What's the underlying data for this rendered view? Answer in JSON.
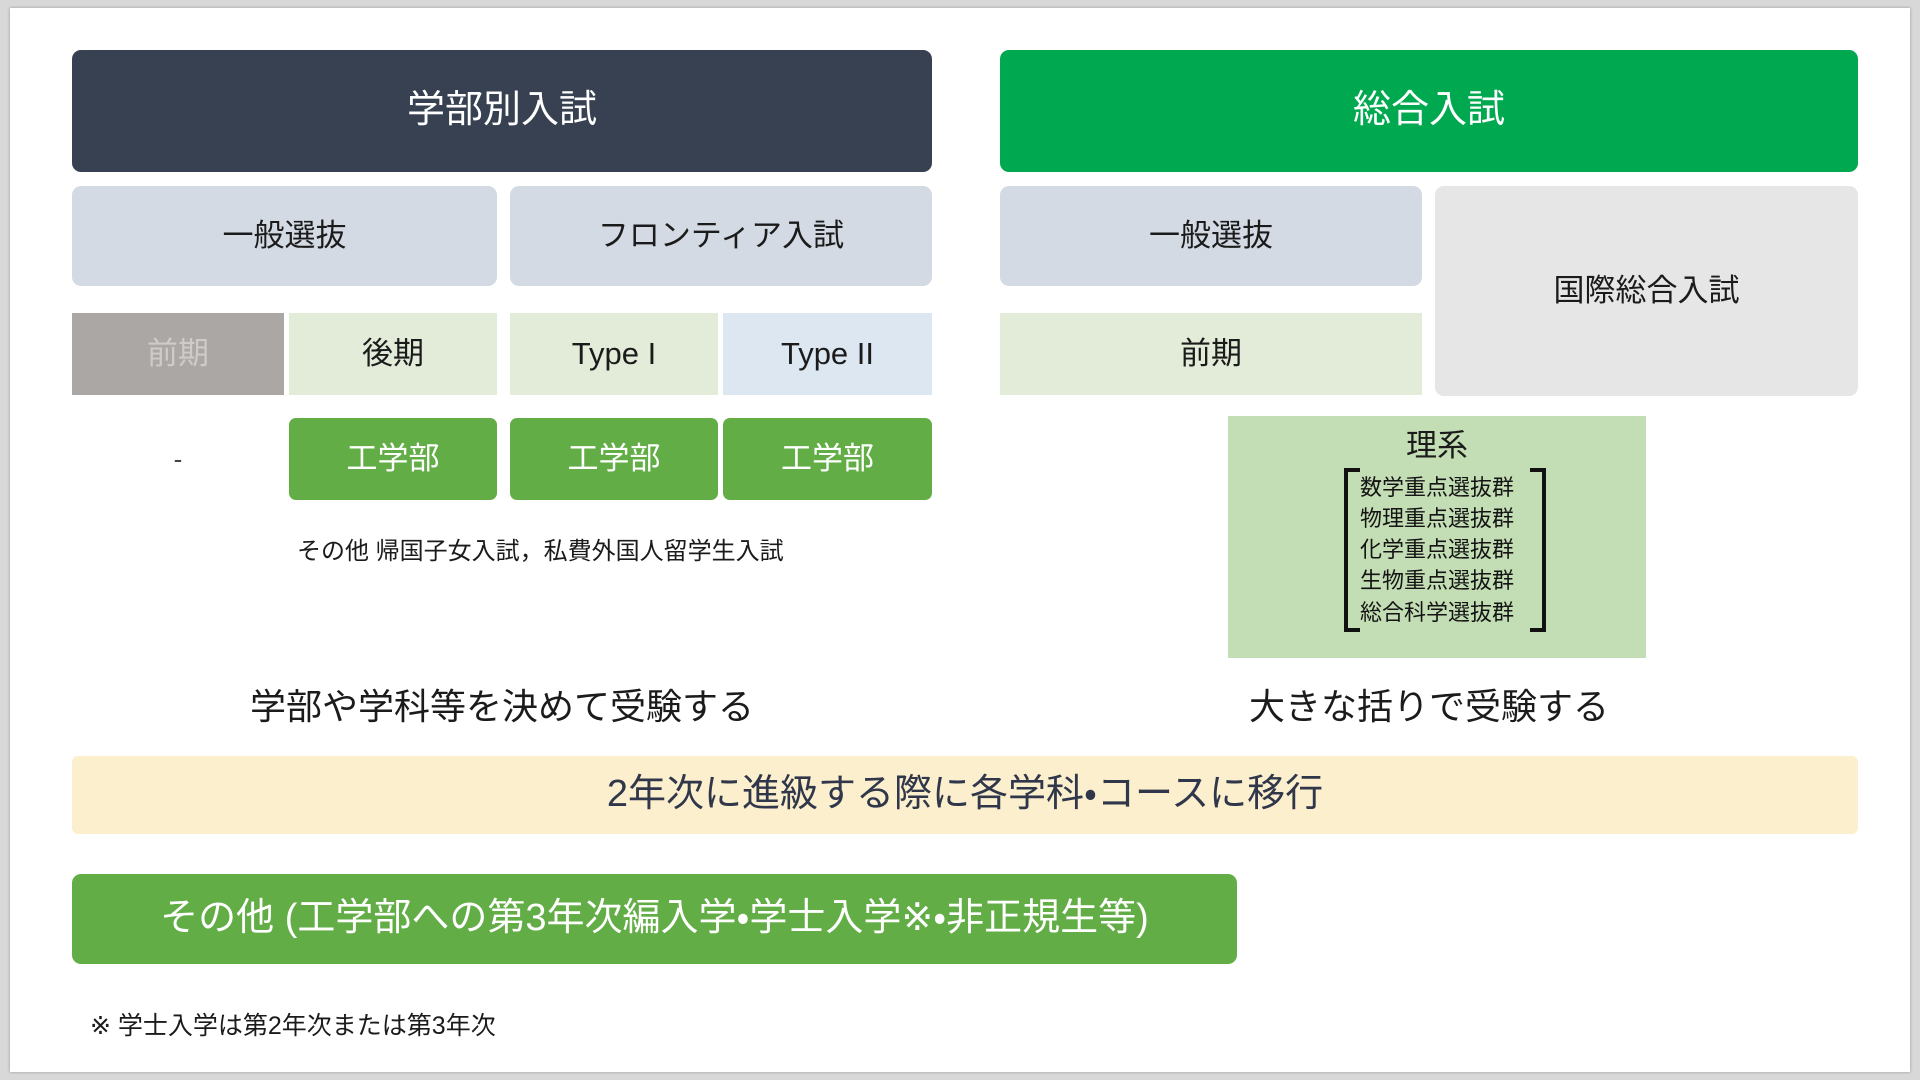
{
  "diagram": {
    "title_left": "学部別入試",
    "title_right": "総合入試",
    "left_column": {
      "tier2": [
        {
          "label": "一般選抜"
        },
        {
          "label": "フロンティア入試"
        }
      ],
      "tier3": [
        {
          "label": "前期",
          "state": "muted"
        },
        {
          "label": "後期",
          "state": "green"
        },
        {
          "label": "Type I",
          "state": "green"
        },
        {
          "label": "Type II",
          "state": "blue"
        }
      ],
      "tier4": [
        {
          "label": "-",
          "kind": "dash"
        },
        {
          "label": "工学部",
          "kind": "dept"
        },
        {
          "label": "工学部",
          "kind": "dept"
        },
        {
          "label": "工学部",
          "kind": "dept"
        }
      ],
      "note": "その他 帰国子女入試，私費外国人留学生入試",
      "caption": "学部や学科等を決めて受験する"
    },
    "right_column": {
      "tier2": [
        {
          "label": "一般選抜"
        },
        {
          "label": "国際総合入試"
        }
      ],
      "tier3": [
        {
          "label": "前期",
          "state": "green"
        }
      ],
      "rikei": {
        "title": "理系",
        "groups": [
          "数学重点選抜群",
          "物理重点選抜群",
          "化学重点選抜群",
          "生物重点選抜群",
          "総合科学選抜群"
        ]
      },
      "caption": "大きな括りで受験する"
    },
    "transfer_band": "2年次に進級する際に各学科・コースに移行",
    "other_band": "その他 (工学部への第3年次編入学・学士入学※・非正規生等)",
    "footnote": "※ 学士入学は第2年次または第3年次"
  },
  "colors": {
    "header_dark": "#374151",
    "header_green": "#00a94f",
    "tier2_blue_gray": "#d3dae4",
    "tier2_gray": "#e6e6e6",
    "tier3_muted": "#aba7a4",
    "tier3_green": "#e2ecd9",
    "tier3_blue": "#dde7f1",
    "dept_green": "#62ad46",
    "rikei_green": "#c3ddb4",
    "band_yellow": "#fcefcd"
  }
}
